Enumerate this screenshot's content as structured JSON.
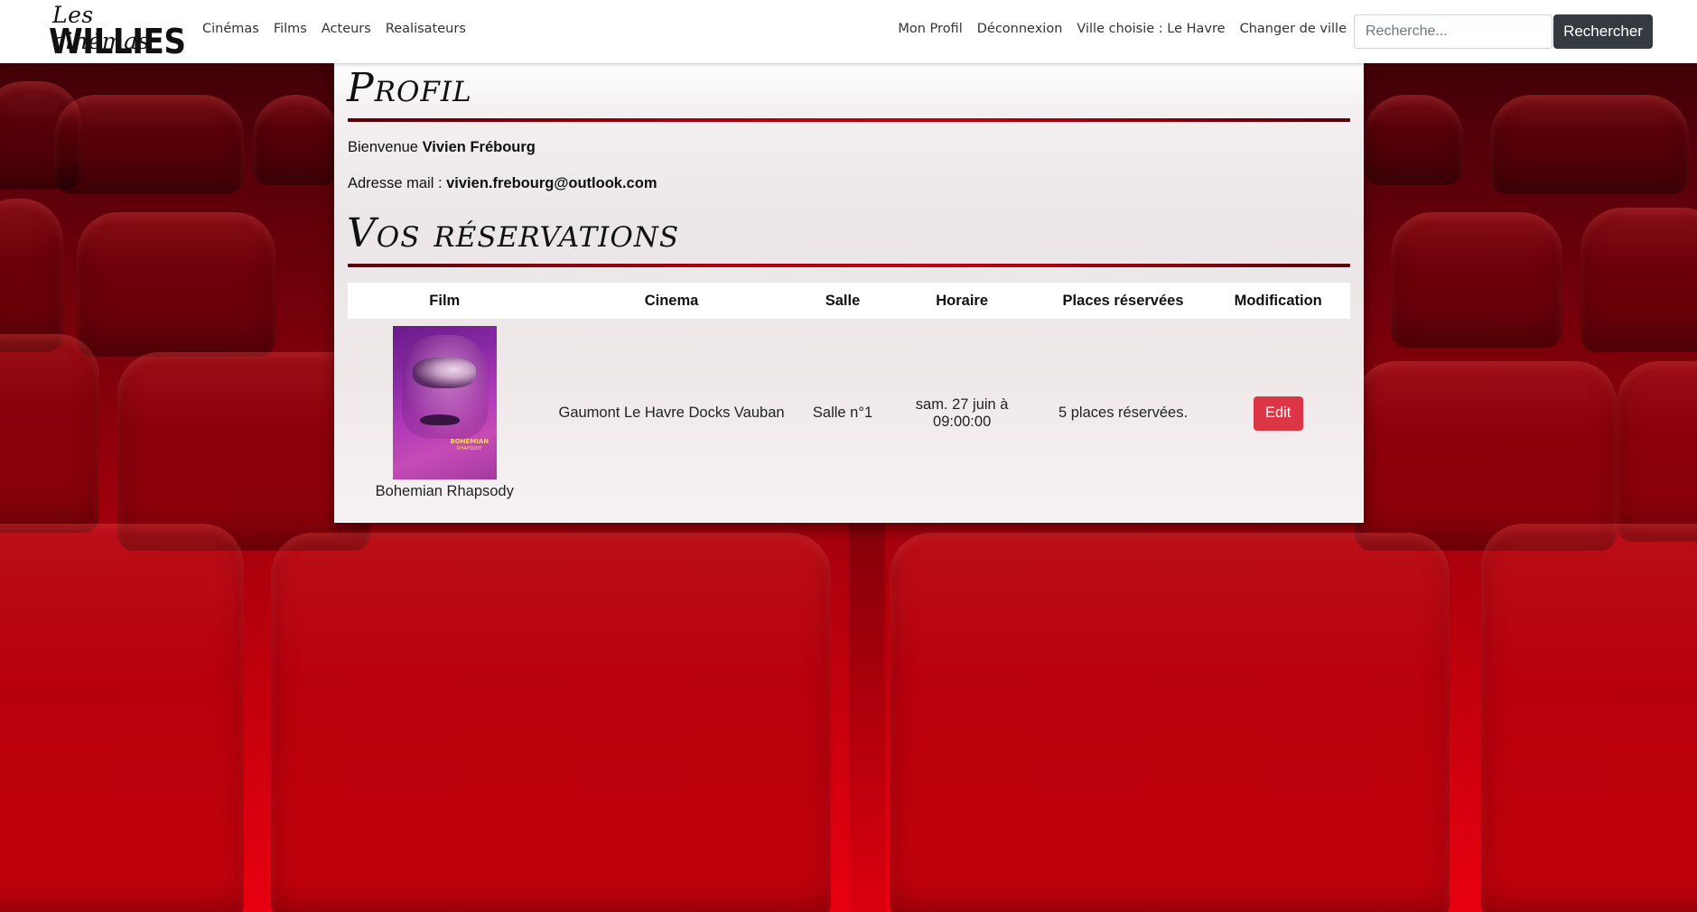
{
  "brand": {
    "line1": "Les cinémas",
    "line2": "WILLIES"
  },
  "nav": {
    "left": [
      "Cinémas",
      "Films",
      "Acteurs",
      "Realisateurs"
    ],
    "right": [
      "Mon Profil",
      "Déconnexion",
      "Ville choisie : Le Havre",
      "Changer de ville"
    ]
  },
  "search": {
    "placeholder": "Recherche...",
    "button": "Rechercher"
  },
  "profile": {
    "title": "Profil",
    "welcome_label": "Bienvenue ",
    "user_name": "Vivien Frébourg",
    "email_label": "Adresse mail : ",
    "email": "vivien.frebourg@outlook.com"
  },
  "reservations": {
    "title": "Vos réservations",
    "columns": [
      "Film",
      "Cinema",
      "Salle",
      "Horaire",
      "Places réservées",
      "Modification"
    ],
    "rows": [
      {
        "film": "Bohemian Rhapsody",
        "poster_title": "BOHEMIAN",
        "poster_subtitle": "RHAPSODY",
        "cinema": "Gaumont Le Havre Docks Vauban",
        "salle": "Salle n°1",
        "horaire": "sam. 27 juin à 09:00:00",
        "places": "5 places réservées.",
        "action": "Edit"
      }
    ]
  },
  "colors": {
    "accent_red": "#dc3545",
    "divider_red": "#b00012",
    "search_button": "#343a40"
  }
}
